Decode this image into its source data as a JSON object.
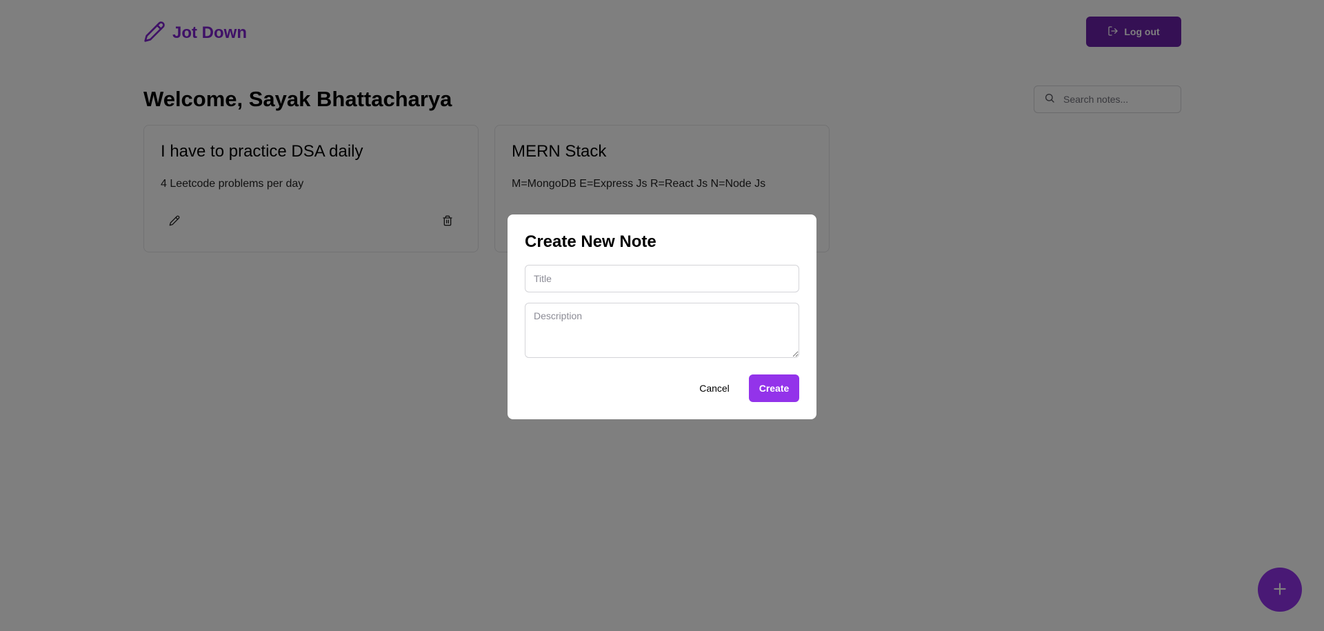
{
  "app": {
    "name": "Jot Down",
    "icon": "pencil-icon",
    "brand_color": "#7e22ce",
    "accent_color": "#9333ea"
  },
  "header": {
    "logout_label": "Log out",
    "logout_icon": "log-out-icon"
  },
  "main": {
    "welcome": "Welcome, Sayak Bhattacharya",
    "search": {
      "placeholder": "Search notes...",
      "value": "",
      "icon": "search-icon"
    },
    "notes": [
      {
        "title": "I have to practice DSA daily",
        "description": "4 Leetcode problems per day",
        "edit_icon": "pencil-icon",
        "delete_icon": "trash-icon"
      },
      {
        "title": "MERN Stack",
        "description": "M=MongoDB E=Express Js R=React Js N=Node Js",
        "edit_icon": "pencil-icon",
        "delete_icon": "trash-icon"
      }
    ]
  },
  "fab": {
    "icon": "plus-icon"
  },
  "modal": {
    "title": "Create New Note",
    "title_field": {
      "placeholder": "Title",
      "value": ""
    },
    "description_field": {
      "placeholder": "Description",
      "value": ""
    },
    "cancel_label": "Cancel",
    "create_label": "Create"
  }
}
